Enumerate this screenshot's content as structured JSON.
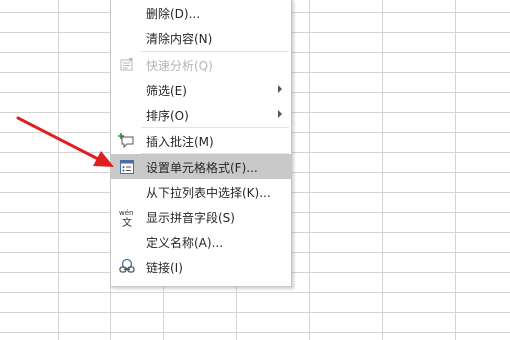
{
  "context_menu": {
    "items": [
      {
        "label": "删除(D)...",
        "icon": "none",
        "submenu": false,
        "disabled": false
      },
      {
        "label": "清除内容(N)",
        "icon": "none",
        "submenu": false,
        "disabled": false
      },
      {
        "label": "快速分析(Q)",
        "icon": "quick-analysis-icon",
        "submenu": false,
        "disabled": true
      },
      {
        "label": "筛选(E)",
        "icon": "none",
        "submenu": true,
        "disabled": false
      },
      {
        "label": "排序(O)",
        "icon": "none",
        "submenu": true,
        "disabled": false
      },
      {
        "label": "插入批注(M)",
        "icon": "comment-icon",
        "submenu": false,
        "disabled": false
      },
      {
        "label": "设置单元格格式(F)...",
        "icon": "format-cells-icon",
        "submenu": false,
        "disabled": false,
        "highlighted": true
      },
      {
        "label": "从下拉列表中选择(K)...",
        "icon": "none",
        "submenu": false,
        "disabled": false
      },
      {
        "label": "显示拼音字段(S)",
        "icon": "phonetic-icon",
        "submenu": false,
        "disabled": false
      },
      {
        "label": "定义名称(A)...",
        "icon": "none",
        "submenu": false,
        "disabled": false
      },
      {
        "label": "链接(I)",
        "icon": "link-icon",
        "submenu": false,
        "disabled": false
      }
    ],
    "phonetic_icon_text": {
      "top": "wén",
      "bottom": "文"
    }
  },
  "colors": {
    "annotation_arrow": "#e02020",
    "highlight": "#c9c9c9",
    "grid": "#d4d4d4"
  }
}
